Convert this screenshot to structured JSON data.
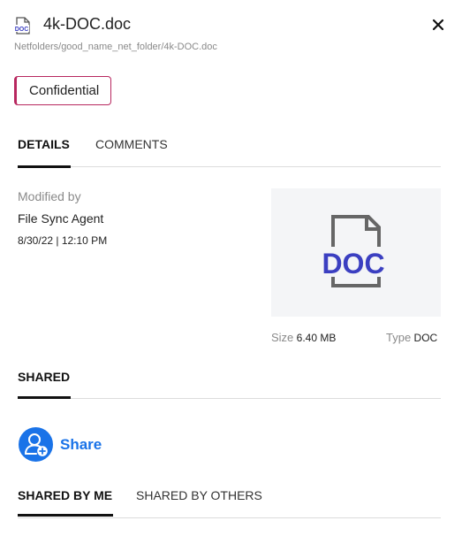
{
  "header": {
    "file_icon": "doc-file-icon",
    "file_icon_text": "DOC",
    "title": "4k-DOC.doc",
    "path": "Netfolders/good_name_net_folder/4k-DOC.doc",
    "close_icon": "close-icon"
  },
  "tag": {
    "label": "Confidential",
    "color": "#b8275f"
  },
  "tabs": [
    {
      "label": "DETAILS",
      "active": true
    },
    {
      "label": "COMMENTS",
      "active": false
    }
  ],
  "details": {
    "modified_by_label": "Modified by",
    "modified_by_value": "File Sync Agent",
    "modified_date": "8/30/22 | 12:10 PM",
    "preview_text": "DOC",
    "preview_icon": "doc-preview-icon",
    "size_label": "Size",
    "size_value": "6.40 MB",
    "type_label": "Type",
    "type_value": "DOC"
  },
  "shared": {
    "heading": "SHARED",
    "share_icon": "add-user-icon",
    "share_label": "Share",
    "accent_color": "#1a73e8",
    "tabs": [
      {
        "label": "SHARED BY ME",
        "active": true
      },
      {
        "label": "SHARED BY OTHERS",
        "active": false
      }
    ]
  }
}
